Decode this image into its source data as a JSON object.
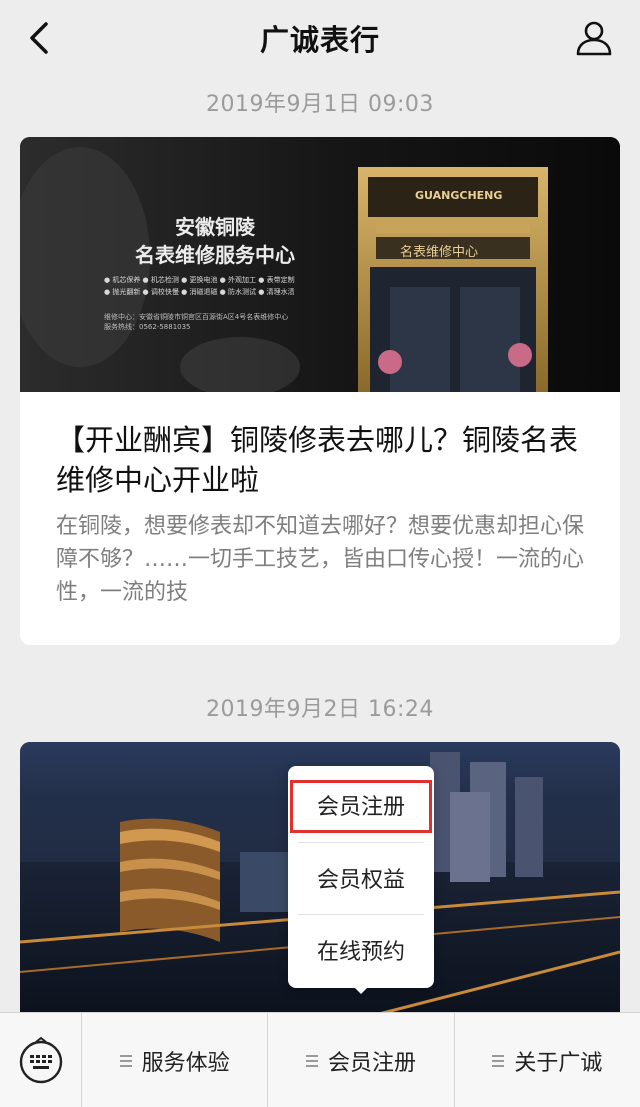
{
  "header": {
    "title": "广诚表行",
    "back_icon": "chevron-left-icon",
    "profile_icon": "person-icon"
  },
  "messages": [
    {
      "timestamp": "2019年9月1日 09:03",
      "cover": {
        "headline_line1": "安徽铜陵",
        "headline_line2": "名表维修服务中心",
        "services_row1": "● 机芯保养  ● 机芯检测  ● 更换电池  ● 外观加工  ● 表带定制",
        "services_row2": "● 抛光翻新  ● 调校快慢  ● 消磁退磁  ● 防水测试  ● 清理水渍",
        "address": "维修中心：安徽省铜陵市铜官区百源街A区4号名表维修中心",
        "hotline": "服务热线：0562-5881035",
        "store_sign_top": "GUANGCHENG",
        "store_sign_bottom": "名表维修中心"
      },
      "title": "【开业酬宾】铜陵修表去哪儿？铜陵名表维修中心开业啦",
      "description": "在铜陵，想要修表却不知道去哪好？想要优惠却担心保障不够？……一切手工技艺，皆由口传心授！一流的心性，一流的技"
    },
    {
      "timestamp": "2019年9月2日 16:24"
    }
  ],
  "popup_menu": {
    "items": [
      "会员注册",
      "会员权益",
      "在线预约"
    ],
    "highlighted_index": 0
  },
  "bottom_menu": {
    "keyboard_icon": "keyboard-icon",
    "tabs": [
      "服务体验",
      "会员注册",
      "关于广诚"
    ]
  },
  "colors": {
    "background": "#ededed",
    "highlight_border": "#e0312f",
    "timestamp_text": "#9b9b9b",
    "description_text": "#7f7f7f"
  }
}
